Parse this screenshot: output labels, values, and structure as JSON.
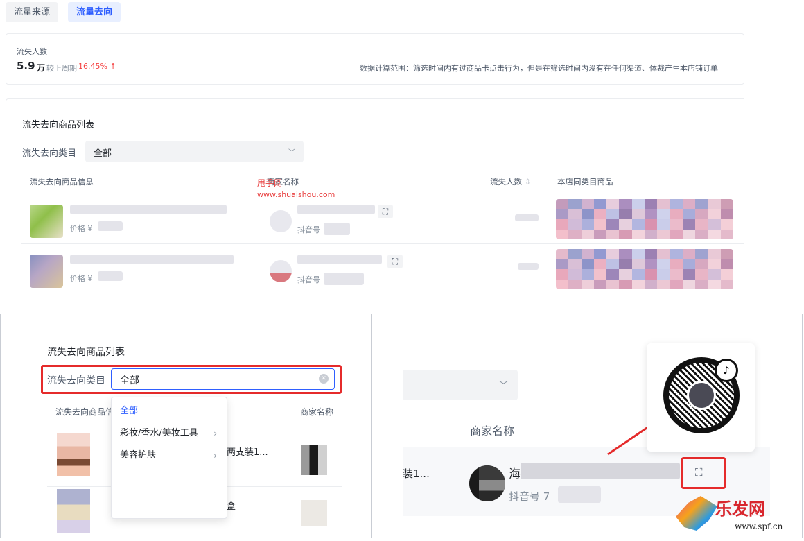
{
  "tabs": [
    {
      "label": "流量来源",
      "active": false
    },
    {
      "label": "流量去向",
      "active": true
    }
  ],
  "summary": {
    "label": "流失人数",
    "value": "5.9",
    "unit": "万",
    "compare_label": "较上周期",
    "compare_pct": "16.45%",
    "trend_icon": "arrow-up-icon",
    "note": "数据计算范围：筛选时间内有过商品卡点击行为，但是在筛选时间内没有在任何渠道、体裁产生本店铺订单"
  },
  "list": {
    "title": "流失去向商品列表",
    "filter_label": "流失去向类目",
    "filter_value": "全部",
    "columns": [
      "流失去向商品信息",
      "商家名称",
      "流失人数",
      "本店同类目商品"
    ],
    "rows": [
      {
        "price_label": "价格 ¥",
        "douyin_label": "抖音号"
      },
      {
        "price_label": "价格 ¥",
        "douyin_label": "抖音号"
      }
    ]
  },
  "watermark": {
    "line1": "甩手网",
    "line2": "www.shuaishou.com"
  },
  "zoom_left": {
    "title": "流失去向商品列表",
    "filter_label": "流失去向类目",
    "filter_value": "全部",
    "columns": [
      "流失去向商品信",
      "商家名称"
    ],
    "dropdown": [
      {
        "label": "全部",
        "selected": true,
        "has_children": false
      },
      {
        "label": "彩妆/香水/美妆工具",
        "selected": false,
        "has_children": true
      },
      {
        "label": "美容护肤",
        "selected": false,
        "has_children": true
      }
    ],
    "row_text_1": "两支装1...",
    "row_text_2": "盒"
  },
  "zoom_right": {
    "column": "商家名称",
    "trunc_text": "装1...",
    "merchant_initial": "海",
    "douyin_label": "抖音号 7",
    "qr_icon": "scan-qr-icon"
  },
  "site_logo": {
    "name": "乐发网",
    "url": "www.spf.cn"
  },
  "colors": {
    "accent": "#2f5fff",
    "danger": "#f53f3f",
    "highlight": "#e52b2b"
  }
}
